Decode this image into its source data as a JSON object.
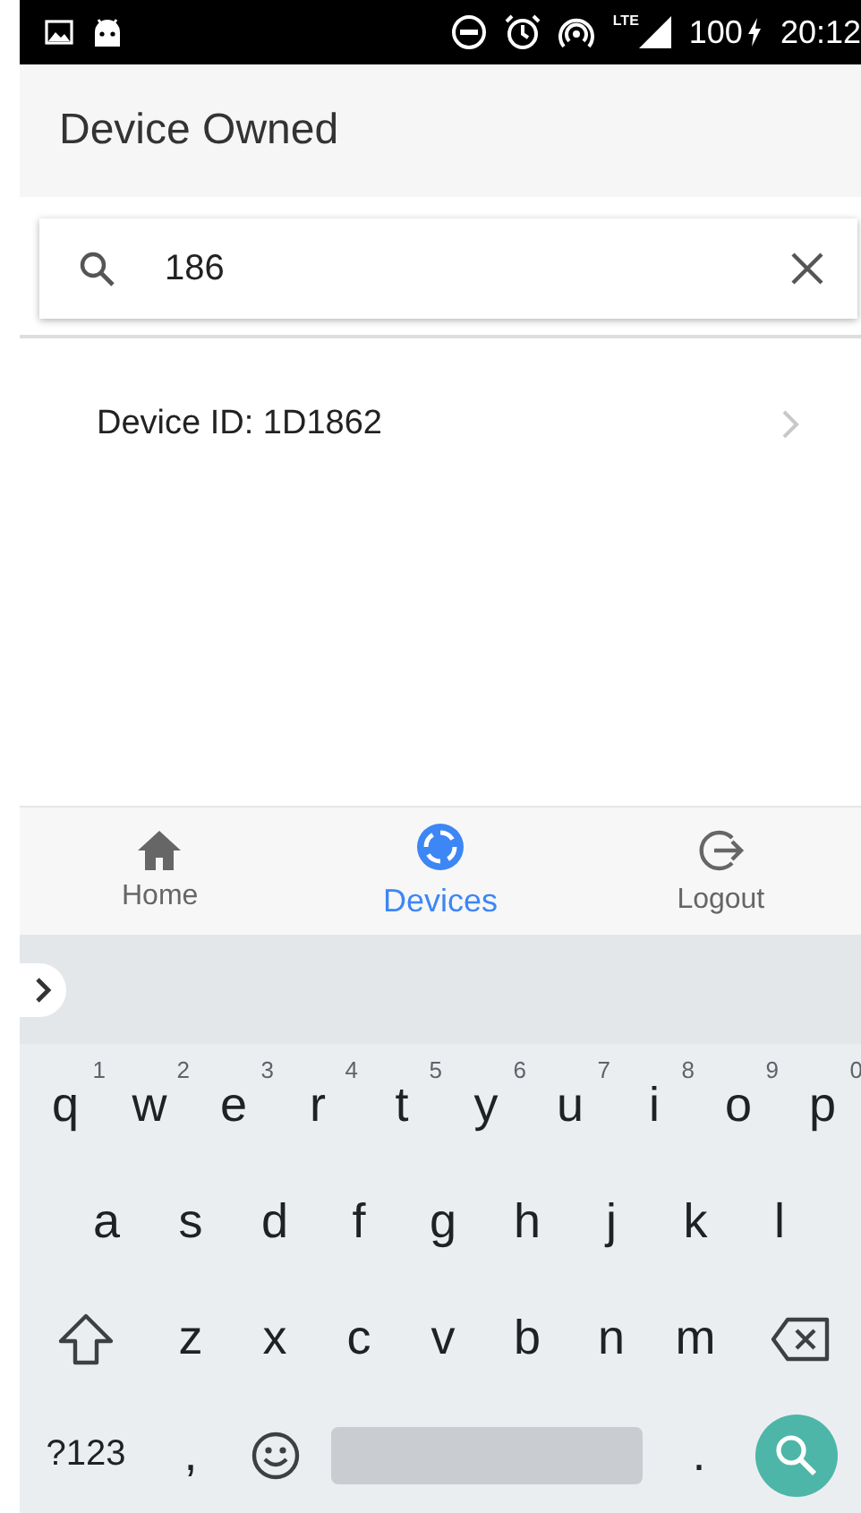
{
  "status_bar": {
    "network": "LTE",
    "battery": "100",
    "time": "20:12"
  },
  "header": {
    "title": "Device Owned"
  },
  "search": {
    "value": "186"
  },
  "results": [
    {
      "label": "Device ID: 1D1862"
    }
  ],
  "bottom_nav": [
    {
      "label": "Home",
      "selected": false
    },
    {
      "label": "Devices",
      "selected": true
    },
    {
      "label": "Logout",
      "selected": false
    }
  ],
  "keyboard": {
    "rows": [
      [
        {
          "kind": "letter",
          "label": "q",
          "hint": "1"
        },
        {
          "kind": "letter",
          "label": "w",
          "hint": "2"
        },
        {
          "kind": "letter",
          "label": "e",
          "hint": "3"
        },
        {
          "kind": "letter",
          "label": "r",
          "hint": "4"
        },
        {
          "kind": "letter",
          "label": "t",
          "hint": "5"
        },
        {
          "kind": "letter",
          "label": "y",
          "hint": "6"
        },
        {
          "kind": "letter",
          "label": "u",
          "hint": "7"
        },
        {
          "kind": "letter",
          "label": "i",
          "hint": "8"
        },
        {
          "kind": "letter",
          "label": "o",
          "hint": "9"
        },
        {
          "kind": "letter",
          "label": "p",
          "hint": "0"
        }
      ],
      [
        {
          "kind": "letter",
          "label": "a"
        },
        {
          "kind": "letter",
          "label": "s"
        },
        {
          "kind": "letter",
          "label": "d"
        },
        {
          "kind": "letter",
          "label": "f"
        },
        {
          "kind": "letter",
          "label": "g"
        },
        {
          "kind": "letter",
          "label": "h"
        },
        {
          "kind": "letter",
          "label": "j"
        },
        {
          "kind": "letter",
          "label": "k"
        },
        {
          "kind": "letter",
          "label": "l"
        }
      ],
      [
        {
          "kind": "shift"
        },
        {
          "kind": "letter",
          "label": "z"
        },
        {
          "kind": "letter",
          "label": "x"
        },
        {
          "kind": "letter",
          "label": "c"
        },
        {
          "kind": "letter",
          "label": "v"
        },
        {
          "kind": "letter",
          "label": "b"
        },
        {
          "kind": "letter",
          "label": "n"
        },
        {
          "kind": "letter",
          "label": "m"
        },
        {
          "kind": "backspace"
        }
      ]
    ],
    "bottom_row": {
      "symbols_key": "?123",
      "comma_key": ",",
      "period_key": "."
    }
  }
}
